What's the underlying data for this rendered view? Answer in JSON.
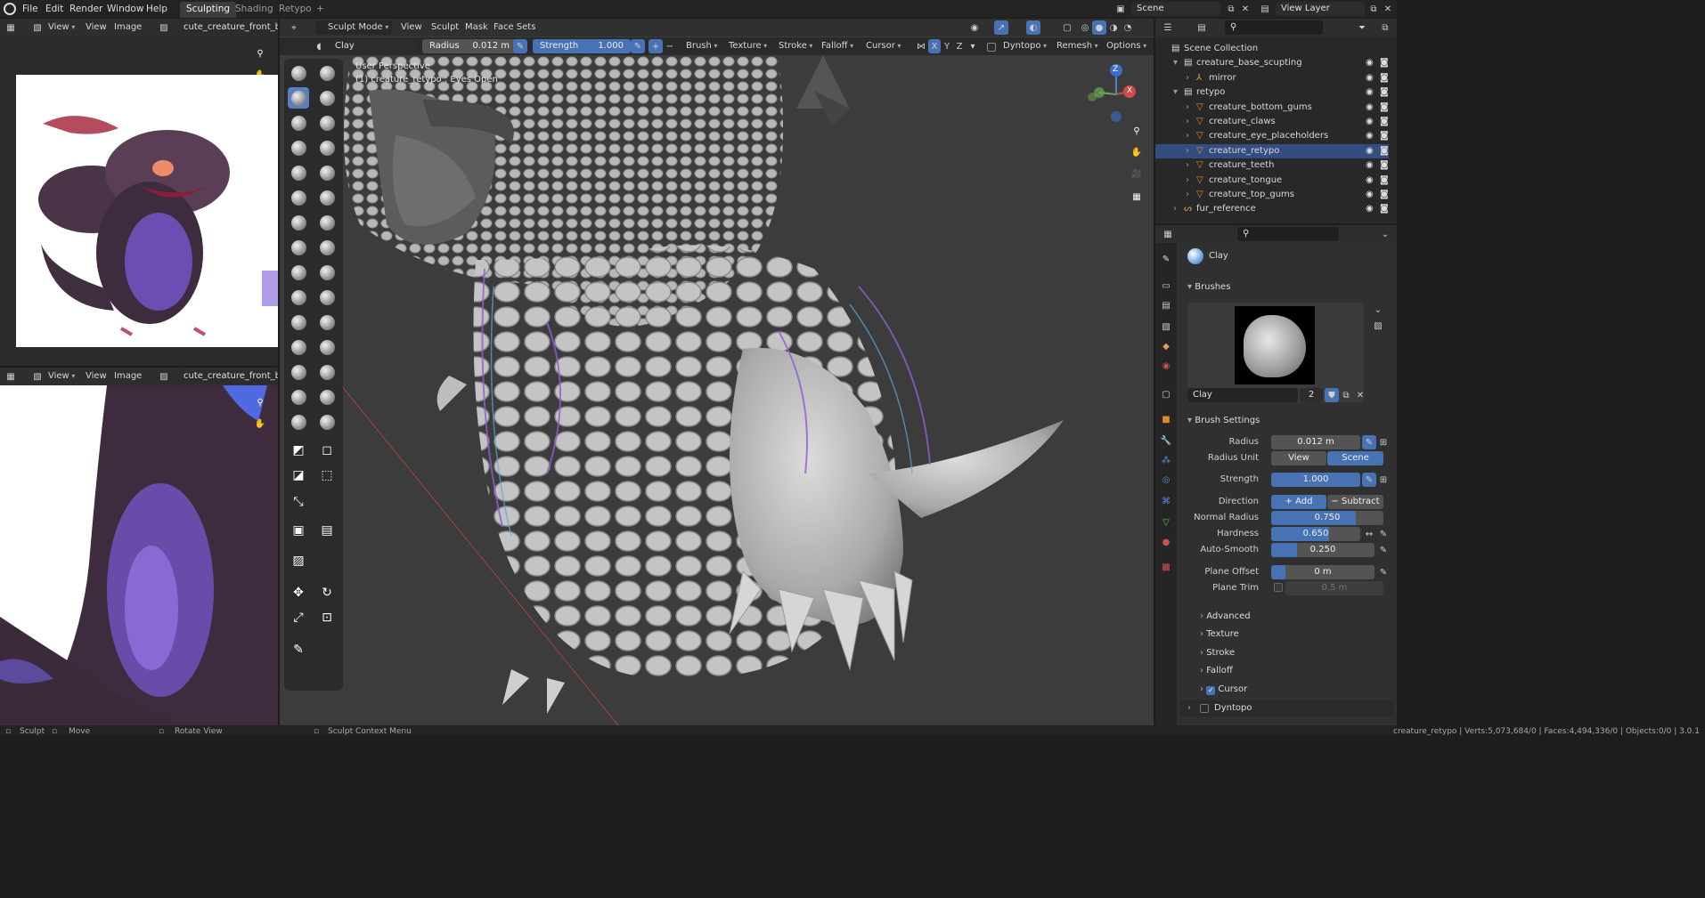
{
  "topbar": {
    "menus": [
      "File",
      "Edit",
      "Render",
      "Window",
      "Help"
    ],
    "workspaces": [
      "Sculpting",
      "Shading",
      "Retypo"
    ],
    "scene": "Scene",
    "view_layer": "View Layer"
  },
  "image_editor_top": {
    "view": "View",
    "view2": "View",
    "image": "Image",
    "image_name": "cute_creature_front_back."
  },
  "image_editor_bottom": {
    "view": "View",
    "view2": "View",
    "image": "Image",
    "image_name": "cute_creature_front_back."
  },
  "viewport_header": {
    "mode": "Sculpt Mode",
    "menus": [
      "View",
      "Sculpt",
      "Mask",
      "Face Sets"
    ]
  },
  "tool_header": {
    "brush_name": "Clay",
    "radius_label": "Radius",
    "radius_value": "0.012 m",
    "strength_label": "Strength",
    "strength_value": "1.000",
    "menus": [
      "Brush",
      "Texture",
      "Stroke",
      "Falloff",
      "Cursor"
    ],
    "axes": [
      "X",
      "Y",
      "Z"
    ],
    "dyntopo": "Dyntopo",
    "remesh": "Remesh",
    "options": "Options"
  },
  "viewport": {
    "perspective": "User Perspective",
    "object_info": "(1) creature_retypo : Eyes Open",
    "gizmo": {
      "x": "X",
      "y": "Y",
      "z": "Z"
    }
  },
  "outliner": {
    "rows": [
      {
        "label": "Scene Collection",
        "level": 0,
        "type": "collection"
      },
      {
        "label": "creature_base_scupting",
        "level": 1,
        "type": "collection"
      },
      {
        "label": "mirror",
        "level": 2,
        "type": "empty"
      },
      {
        "label": "retypo",
        "level": 1,
        "type": "collection"
      },
      {
        "label": "creature_bottom_gums",
        "level": 2,
        "type": "mesh"
      },
      {
        "label": "creature_claws",
        "level": 2,
        "type": "mesh"
      },
      {
        "label": "creature_eye_placeholders",
        "level": 2,
        "type": "mesh"
      },
      {
        "label": "creature_retypo",
        "level": 2,
        "type": "mesh"
      },
      {
        "label": "creature_teeth",
        "level": 2,
        "type": "mesh"
      },
      {
        "label": "creature_tongue",
        "level": 2,
        "type": "mesh"
      },
      {
        "label": "creature_top_gums",
        "level": 2,
        "type": "mesh"
      },
      {
        "label": "fur_reference",
        "level": 1,
        "type": "curve"
      }
    ]
  },
  "properties": {
    "active_brush": "Clay",
    "brushes_panel": "Brushes",
    "brush_name": "Clay",
    "brush_users": "2",
    "brush_settings_panel": "Brush Settings",
    "radius_label": "Radius",
    "radius_value": "0.012 m",
    "radius_unit_label": "Radius Unit",
    "radius_unit_view": "View",
    "radius_unit_scene": "Scene",
    "strength_label": "Strength",
    "strength_value": "1.000",
    "direction_label": "Direction",
    "direction_add": "Add",
    "direction_subtract": "Subtract",
    "normal_radius_label": "Normal Radius",
    "normal_radius_value": "0.750",
    "hardness_label": "Hardness",
    "hardness_value": "0.650",
    "autosmooth_label": "Auto-Smooth",
    "autosmooth_value": "0.250",
    "plane_offset_label": "Plane Offset",
    "plane_offset_value": "0 m",
    "plane_trim_label": "Plane Trim",
    "plane_trim_value": "0.5 m",
    "subpanels": [
      "Advanced",
      "Texture",
      "Stroke",
      "Falloff",
      "Cursor"
    ],
    "dyntopo_panel": "Dyntopo"
  },
  "statusbar": {
    "sculpt": "Sculpt",
    "move": "Move",
    "rotate": "Rotate View",
    "context": "Sculpt Context Menu",
    "stats": "creature_retypo | Verts:5,073,684/0 | Faces:4,494,336/0 | Objects:0/0 | 3.0.1"
  },
  "colors": {
    "accent": "#4772b3",
    "active_tool": "#5680c2",
    "panel": "#303030",
    "viewport_bg": "#3c3c3c"
  }
}
